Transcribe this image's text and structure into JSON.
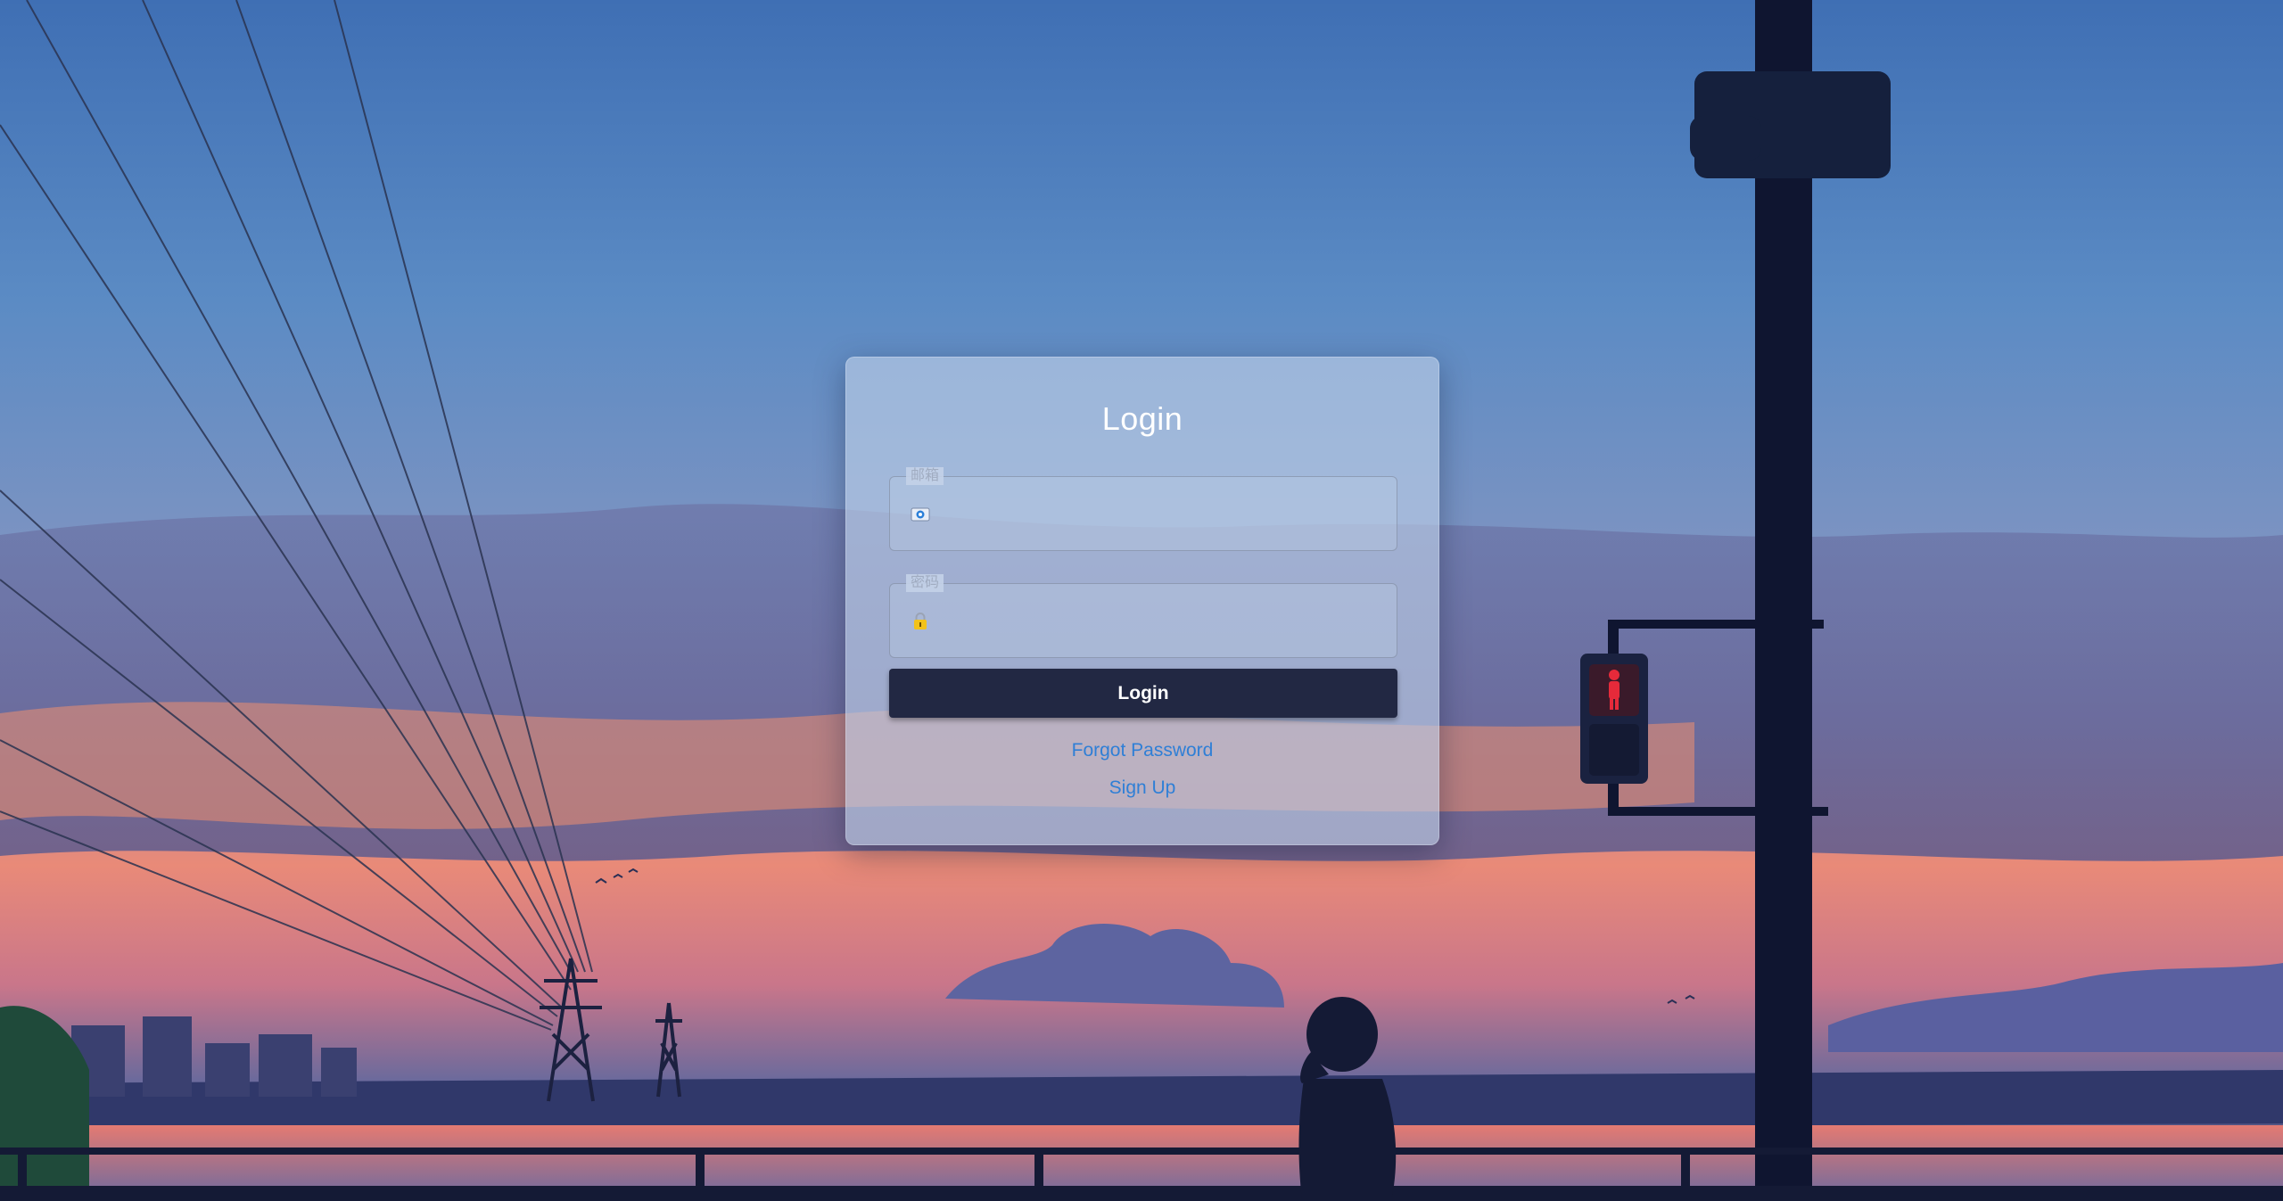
{
  "login_card": {
    "title": "Login",
    "email_field": {
      "label": "邮箱",
      "value": "",
      "icon": "email-icon"
    },
    "password_field": {
      "label": "密码",
      "value": "",
      "icon": "lock-icon"
    },
    "login_button_label": "Login",
    "forgot_password_label": "Forgot Password",
    "sign_up_label": "Sign Up"
  },
  "colors": {
    "button_background": "#222843",
    "link": "#2f7fd6",
    "title": "#ffffff",
    "card_background": "rgba(190,208,232,0.62)"
  },
  "background": {
    "description_icon": "sunset-scenery-wallpaper"
  }
}
